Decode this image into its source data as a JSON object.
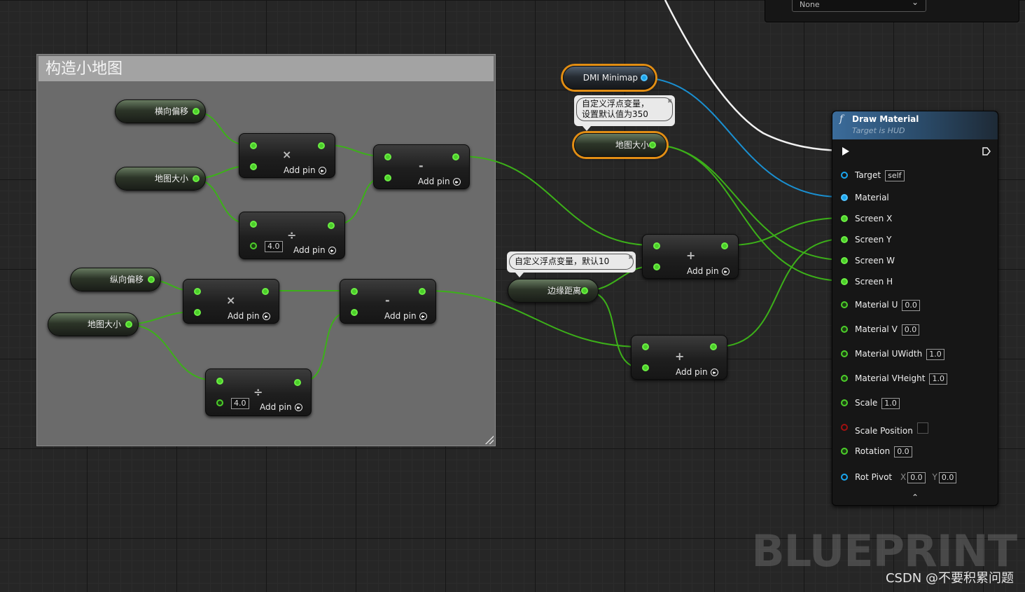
{
  "comment_box": {
    "title": "构造小地图"
  },
  "variables": {
    "horizontal_offset": "横向偏移",
    "vertical_offset": "纵向偏移",
    "map_size": "地图大小",
    "dmi_minimap": "DMI Minimap",
    "edge_distance": "边缘距离"
  },
  "math_nodes": {
    "multiply_symbol": "×",
    "divide_symbol": "÷",
    "subtract_symbol": "-",
    "add_symbol": "+",
    "add_pin_label": "Add pin",
    "divisor_value": "4.0"
  },
  "comment_bubbles": {
    "map_size_note_line1": "自定义浮点变量，",
    "map_size_note_line2": "设置默认值为350",
    "edge_distance_note": "自定义浮点变量，默认10"
  },
  "draw_material": {
    "title": "Draw Material",
    "subtitle": "Target is HUD",
    "pins": {
      "target": {
        "label": "Target",
        "value": "self"
      },
      "material": {
        "label": "Material"
      },
      "screen_x": {
        "label": "Screen X"
      },
      "screen_y": {
        "label": "Screen Y"
      },
      "screen_w": {
        "label": "Screen W"
      },
      "screen_h": {
        "label": "Screen H"
      },
      "material_u": {
        "label": "Material U",
        "value": "0.0"
      },
      "material_v": {
        "label": "Material V",
        "value": "0.0"
      },
      "material_uwidth": {
        "label": "Material UWidth",
        "value": "1.0"
      },
      "material_vheight": {
        "label": "Material VHeight",
        "value": "1.0"
      },
      "scale": {
        "label": "Scale",
        "value": "1.0"
      },
      "scale_position": {
        "label": "Scale Position"
      },
      "rotation": {
        "label": "Rotation",
        "value": "0.0"
      },
      "rot_pivot": {
        "label": "Rot Pivot",
        "x_label": "X",
        "x_value": "0.0",
        "y_label": "Y",
        "y_value": "0.0"
      }
    }
  },
  "top_node": {
    "dropdown_value": "None"
  },
  "watermark": "BLUEPRINT",
  "credit": "CSDN @不要积累问题",
  "colors": {
    "float_pin": "#4ccf2a",
    "object_pin": "#1aa6ee",
    "exec_pin": "#ffffff",
    "bool_pin": "#a01010",
    "selection": "#e28e14",
    "function_header": "#3b6c9b",
    "comment_bg": "#6b6b6b",
    "comment_title_bg": "#a3a3a3"
  }
}
